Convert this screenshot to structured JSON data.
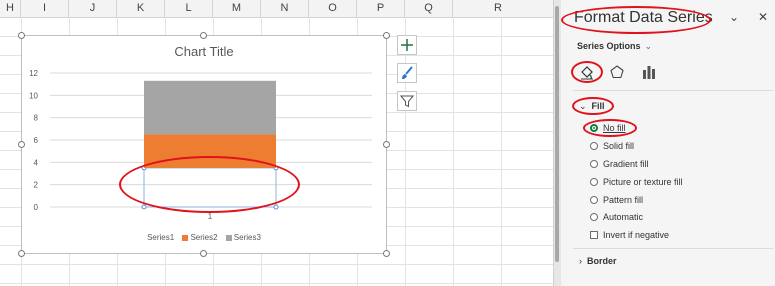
{
  "columns": [
    "H",
    "I",
    "J",
    "K",
    "L",
    "M",
    "N",
    "O",
    "P",
    "Q",
    "R"
  ],
  "chart": {
    "title": "Chart Title",
    "y_ticks": [
      "0",
      "2",
      "4",
      "6",
      "8",
      "10",
      "12"
    ],
    "x_ticks": [
      "1"
    ],
    "legend": [
      {
        "name": "Series1",
        "color": "#ffffff"
      },
      {
        "name": "Series2",
        "color": "#ed7d31"
      },
      {
        "name": "Series3",
        "color": "#a5a5a5"
      }
    ]
  },
  "chart_data": {
    "type": "bar",
    "stacked": true,
    "title": "Chart Title",
    "categories": [
      "1"
    ],
    "series": [
      {
        "name": "Series1",
        "values": [
          3.5
        ],
        "fill": "none"
      },
      {
        "name": "Series2",
        "values": [
          3
        ],
        "fill": "#ed7d31"
      },
      {
        "name": "Series3",
        "values": [
          4.8
        ],
        "fill": "#a5a5a5"
      }
    ],
    "ylim": [
      0,
      12
    ],
    "yticks": [
      0,
      2,
      4,
      6,
      8,
      10,
      12
    ],
    "grid": true,
    "legend_position": "bottom"
  },
  "chart_tools": [
    "add-chart-element-icon",
    "chart-style-brush-icon",
    "chart-filter-icon"
  ],
  "pane": {
    "title": "Format Data Series",
    "series_options_label": "Series Options",
    "tabs": [
      "fill-line-icon",
      "effects-pentagon-icon",
      "series-options-bars-icon"
    ],
    "fill_label": "Fill",
    "fill_options": [
      {
        "label": "No fill",
        "checked": true
      },
      {
        "label": "Solid fill",
        "checked": false
      },
      {
        "label": "Gradient fill",
        "checked": false
      },
      {
        "label": "Picture or texture fill",
        "checked": false
      },
      {
        "label": "Pattern fill",
        "checked": false
      },
      {
        "label": "Automatic",
        "checked": false
      }
    ],
    "invert_label": "Invert if negative",
    "border_label": "Border"
  }
}
